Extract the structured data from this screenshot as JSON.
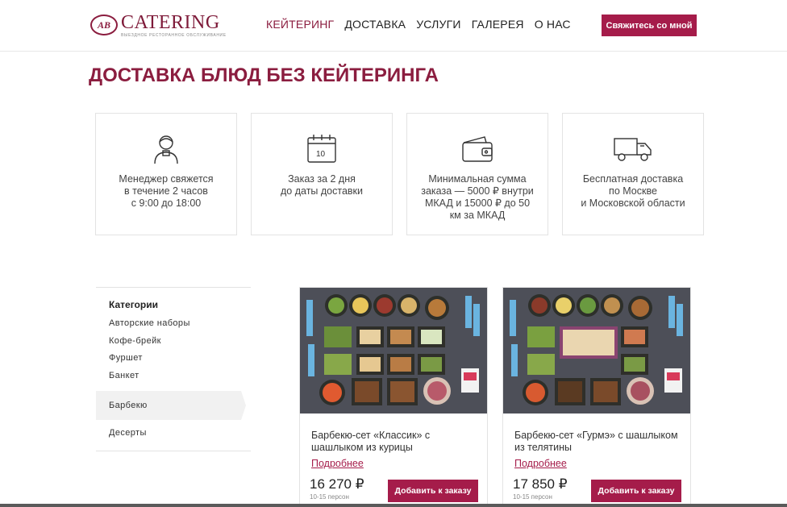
{
  "header": {
    "logo_title": "CATERING",
    "logo_sub": "ВЫЕЗДНОЕ РЕСТОРАННОЕ ОБСЛУЖИВАНИЕ",
    "logo_mark": "AB",
    "nav": [
      {
        "label": "КЕЙТЕРИНГ",
        "active": true
      },
      {
        "label": "ДОСТАВКА",
        "active": false
      },
      {
        "label": "УСЛУГИ",
        "active": false
      },
      {
        "label": "ГАЛЕРЕЯ",
        "active": false
      },
      {
        "label": "О НАС",
        "active": false
      }
    ],
    "contact_button": "Свяжитесь со мной"
  },
  "page_title": "ДОСТАВКА БЛЮД БЕЗ КЕЙТЕРИНГА",
  "features": [
    {
      "icon": "manager-icon",
      "text": "Менеджер свяжется\nв течение 2 часов\nс 9:00 до 18:00"
    },
    {
      "icon": "calendar-icon",
      "icon_text": "10",
      "text": "Заказ за 2 дня\nдо даты доставки"
    },
    {
      "icon": "wallet-icon",
      "text": "Минимальная сумма\nзаказа — 5000 ₽ внутри\nМКАД и 15000 ₽ до 50\nкм за МКАД"
    },
    {
      "icon": "truck-icon",
      "text": "Бесплатная доставка\nпо Москве\nи Московской области"
    }
  ],
  "sidebar": {
    "heading": "Категории",
    "items": [
      {
        "label": "Авторские наборы",
        "active": false
      },
      {
        "label": "Кофе-брейк",
        "active": false
      },
      {
        "label": "Фуршет",
        "active": false
      },
      {
        "label": "Банкет",
        "active": false
      },
      {
        "label": "Барбекю",
        "active": true
      },
      {
        "label": "Десерты",
        "active": false
      }
    ]
  },
  "products": [
    {
      "name": "Барбекю-сет «Классик» с шашлыком из курицы",
      "more": "Подробнее",
      "price": "16 270 ₽",
      "persons": "10-15 персон",
      "button": "Добавить к заказу"
    },
    {
      "name": "Барбекю-сет «Гурмэ» с шашлыком из телятины",
      "more": "Подробнее",
      "price": "17 850 ₽",
      "persons": "10-15 персон",
      "button": "Добавить к заказу"
    }
  ],
  "colors": {
    "brand": "#a51c4a",
    "title": "#8b1d3f",
    "image_bg": "#4a4c55"
  }
}
